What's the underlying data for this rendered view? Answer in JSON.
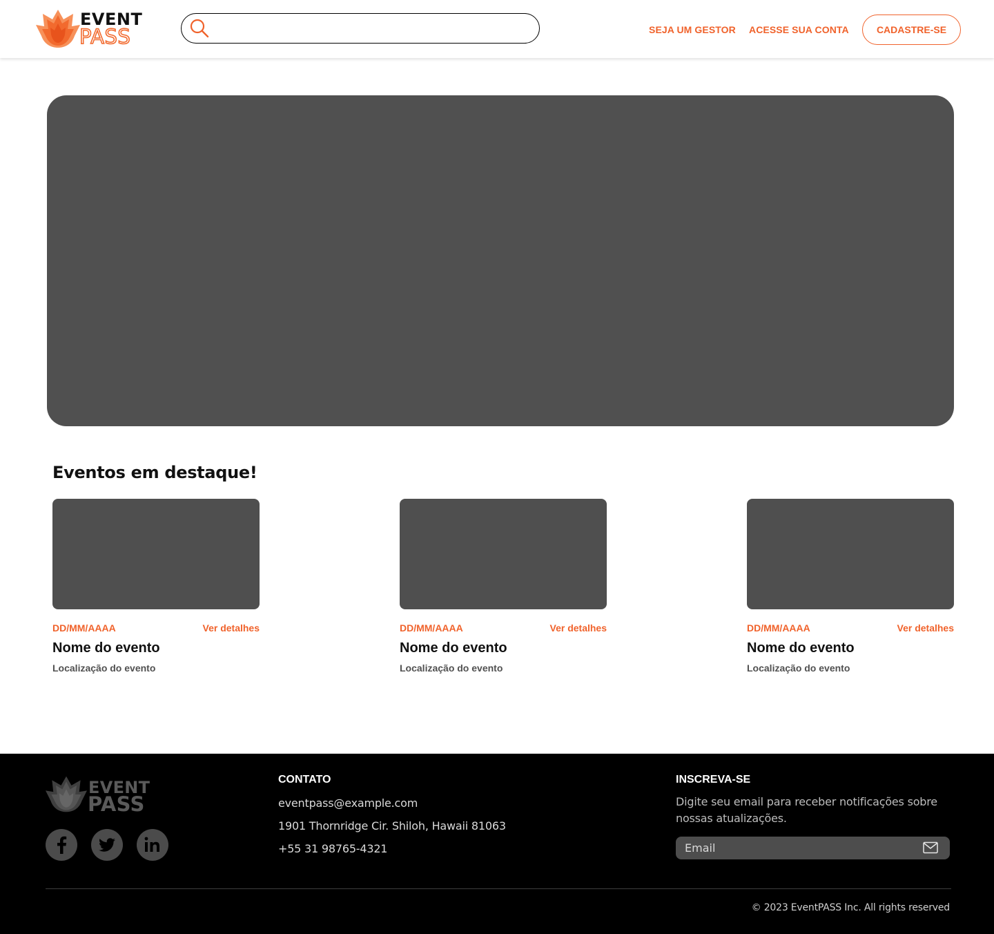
{
  "brand": {
    "logo_line1": "EVENT",
    "logo_line2": "PASS",
    "accent_color": "#f0622b"
  },
  "header": {
    "search": {
      "placeholder": "",
      "value": "",
      "icon": "search-icon"
    },
    "nav": {
      "gestor_label": "SEJA UM GESTOR",
      "acesse_label": "ACESSE SUA CONTA",
      "cadastre_label": "CADASTRE-SE"
    }
  },
  "featured": {
    "title": "Eventos em destaque!",
    "cards": [
      {
        "date": "DD/MM/AAAA",
        "details_label": "Ver detalhes",
        "name": "Nome do evento",
        "location": "Localização do evento"
      },
      {
        "date": "DD/MM/AAAA",
        "details_label": "Ver detalhes",
        "name": "Nome do evento",
        "location": "Localização do evento"
      },
      {
        "date": "DD/MM/AAAA",
        "details_label": "Ver detalhes",
        "name": "Nome do evento",
        "location": "Localização do evento"
      }
    ]
  },
  "footer": {
    "social_icons": [
      "facebook-icon",
      "twitter-icon",
      "linkedin-icon"
    ],
    "contact": {
      "heading": "CONTATO",
      "email": "eventpass@example.com",
      "address": "1901 Thornridge Cir. Shiloh, Hawaii 81063",
      "phone": "+55 31 98765-4321"
    },
    "subscribe": {
      "heading": "INSCREVA-SE",
      "description": "Digite seu email para receber notificações sobre nossas atualizações.",
      "email_placeholder": "Email",
      "send_icon": "mail-icon"
    },
    "copyright": "© 2023 EventPASS Inc. All rights reserved"
  }
}
